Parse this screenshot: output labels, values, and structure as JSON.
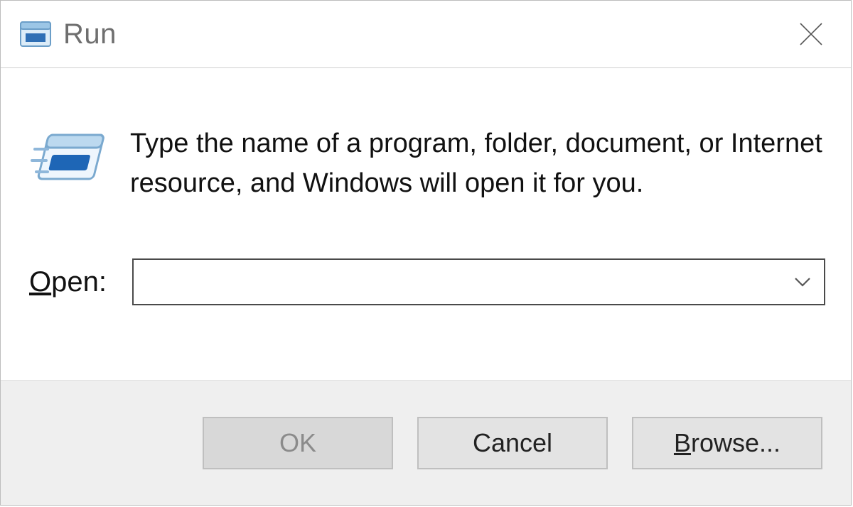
{
  "window": {
    "title": "Run"
  },
  "content": {
    "description": "Type the name of a program, folder, document, or Internet resource, and Windows will open it for you.",
    "open_label_underlined": "O",
    "open_label_rest": "pen:",
    "open_value": ""
  },
  "buttons": {
    "ok": "OK",
    "cancel": "Cancel",
    "browse_underlined": "B",
    "browse_rest": "rowse..."
  },
  "icons": {
    "app": "run-dialog-icon",
    "close": "close-icon",
    "dropdown": "chevron-down-icon",
    "run": "run-program-icon"
  }
}
